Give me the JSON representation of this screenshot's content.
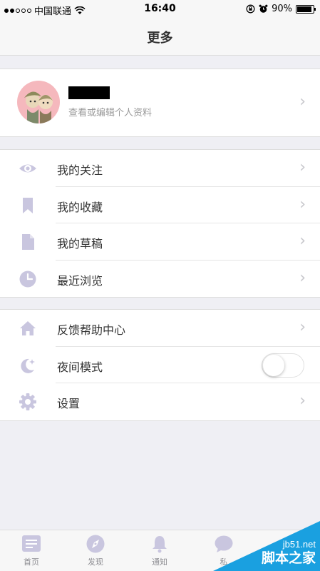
{
  "status_bar": {
    "carrier": "中国联通",
    "time": "16:40",
    "battery": "90%",
    "battery_level": 0.9
  },
  "nav": {
    "title": "更多"
  },
  "profile": {
    "subtitle": "查看或编辑个人资料"
  },
  "menu_group1": [
    {
      "label": "我的关注",
      "icon": "eye-icon"
    },
    {
      "label": "我的收藏",
      "icon": "bookmark-icon"
    },
    {
      "label": "我的草稿",
      "icon": "document-icon"
    },
    {
      "label": "最近浏览",
      "icon": "clock-icon"
    }
  ],
  "menu_group2": [
    {
      "label": "反馈帮助中心",
      "icon": "home-icon"
    },
    {
      "label": "夜间模式",
      "icon": "moon-icon",
      "toggle_on": false
    },
    {
      "label": "设置",
      "icon": "gear-icon"
    }
  ],
  "tabs": [
    {
      "label": "首页",
      "icon": "news-icon"
    },
    {
      "label": "发现",
      "icon": "compass-icon"
    },
    {
      "label": "通知",
      "icon": "bell-icon"
    },
    {
      "label": "私",
      "icon": "chat-icon"
    }
  ],
  "watermark": {
    "url": "jb51.net",
    "name": "脚本之家"
  },
  "colors": {
    "icon": "#c9c6df",
    "background": "#efeff4",
    "watermark": "#1aa0e0"
  }
}
